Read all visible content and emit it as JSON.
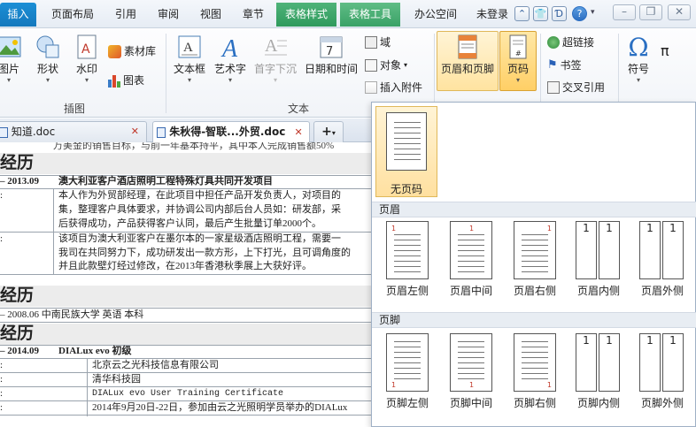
{
  "menu": {
    "tabs": [
      "插入",
      "页面布局",
      "引用",
      "审阅",
      "视图",
      "章节",
      "表格样式",
      "表格工具",
      "办公空间"
    ],
    "login": "未登录"
  },
  "ribbon": {
    "picture": "图片",
    "shape": "形状",
    "watermark": "水印",
    "material": "素材库",
    "chart": "图表",
    "textbox": "文本框",
    "wordart": "艺术字",
    "dropcap": "首字下沉",
    "datetime": "日期和时间",
    "field": "域",
    "object": "对象",
    "attachment": "插入附件",
    "header_footer": "页眉和页脚",
    "page_number": "页码",
    "hyperlink": "超链接",
    "bookmark": "书签",
    "crossref": "交叉引用",
    "symbol": "符号",
    "pi": "π",
    "group_illustration": "插图",
    "group_text": "文本"
  },
  "tabs": {
    "doc1": "知道.doc",
    "doc2": "朱秋得-智联...外贸.doc",
    "plus": "+"
  },
  "doc": {
    "top_line": "万美金的销售目标，与前一年基本持平，其中本人完成销售额50%",
    "sec1": "经历",
    "row1_date": "– 2013.09",
    "row1_title": "澳大利亚客户酒店照明工程特殊灯具共同开发项目",
    "row1_label": ":",
    "row1_text1": "本人作为外贸部经理，在此项目中担任产品开发负责人，对项目的",
    "row1_text2": "集，整理客户具体要求，并协调公司内部后台人员如：研发部，采",
    "row1_text3": "后获得成功，产品获得客户认同，最后产生批量订单2000个。",
    "row2_label": ":",
    "row2_text1": "该项目为澳大利亚客户在墨尔本的一家星级酒店照明工程，需要一",
    "row2_text2": "我司在共同努力下，成功研发出一款方形，上下打光，且可调角度的",
    "row2_text3": "并且此款壁灯经过修改，在2013年香港秋季展上大获好评。",
    "sec2": "经历",
    "edu_line": "– 2008.06   中南民族大学   英语   本科",
    "sec3": "经历",
    "row3_date": "– 2014.09",
    "row3_title": "DIALux evo 初级",
    "r3a": "北京云之光科技信息有限公司",
    "r3b": "清华科技园",
    "r3c": "DIALux evo User Training Certificate",
    "r3d": "2014年9月20日-22日，参加由云之光照明学员举办的DIALux"
  },
  "panel": {
    "none_label": "无页码",
    "header_section": "页眉",
    "footer_section": "页脚",
    "headers": [
      "页眉左侧",
      "页眉中间",
      "页眉右侧",
      "页眉内侧",
      "页眉外侧"
    ],
    "footers": [
      "页脚左侧",
      "页脚中间",
      "页脚右侧",
      "页脚内侧",
      "页脚外侧"
    ],
    "page_num": "1"
  }
}
